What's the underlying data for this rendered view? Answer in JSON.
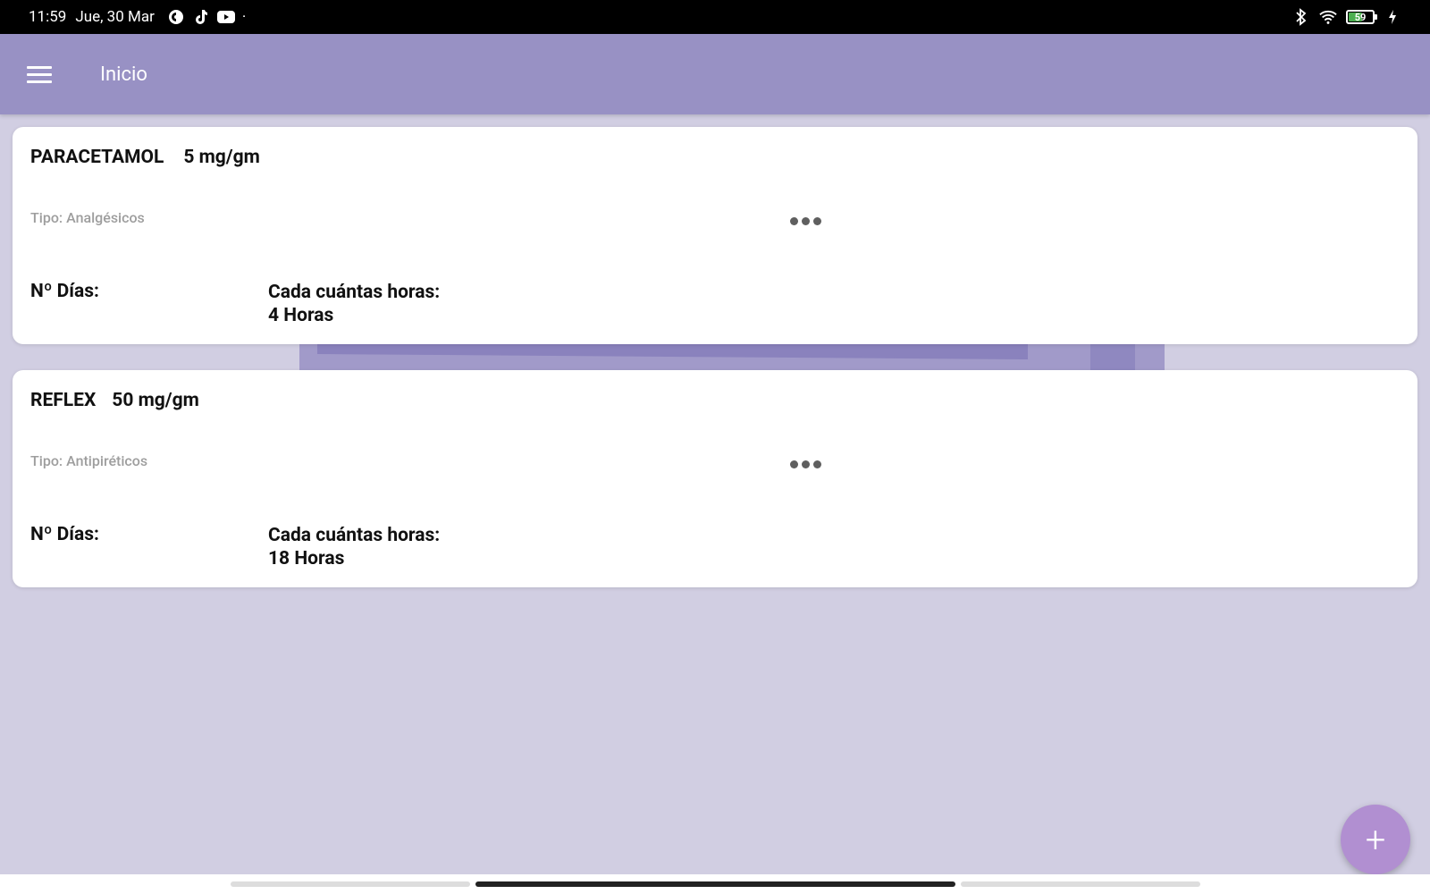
{
  "status_bar": {
    "time": "11:59",
    "date": "Jue, 30 Mar",
    "dot": "·",
    "battery_level": "59",
    "icons": [
      "c-app-icon",
      "tiktok-icon",
      "youtube-icon",
      "bluetooth-icon",
      "wifi-icon",
      "battery-icon",
      "charging-icon"
    ]
  },
  "app_bar": {
    "title": "Inicio",
    "menu_icon": "hamburger-menu-icon",
    "color": "#9891c4"
  },
  "cards": [
    {
      "name": "PARACETAMOL",
      "dose": "5 mg/gm",
      "type": "Tipo: Analgésicos",
      "days_label": "Nº Días:",
      "hours_label": "Cada cuántas horas:",
      "hours_value": "4 Horas"
    },
    {
      "name": "REFLEX",
      "dose": "50 mg/gm",
      "type": "Tipo: Antipiréticos",
      "days_label": "Nº Días:",
      "hours_label": "Cada cuántas horas:",
      "hours_value": "18 Horas"
    }
  ],
  "fab": {
    "label": "+",
    "color": "#b18fd1"
  },
  "colors": {
    "background": "#d1cee2",
    "card": "#ffffff"
  }
}
